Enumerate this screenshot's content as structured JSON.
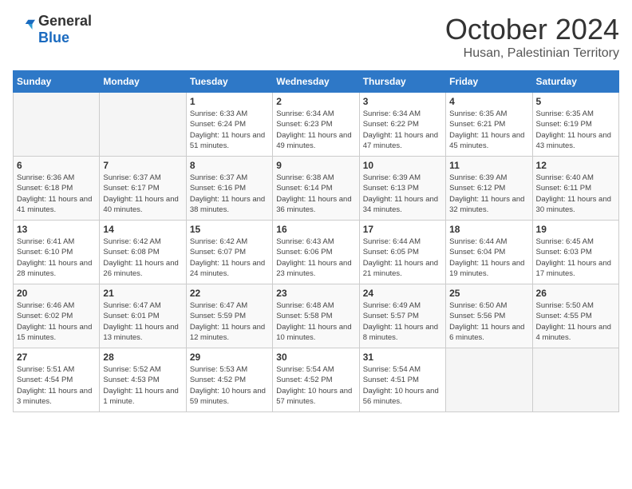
{
  "header": {
    "logo_general": "General",
    "logo_blue": "Blue",
    "month": "October 2024",
    "location": "Husan, Palestinian Territory"
  },
  "weekdays": [
    "Sunday",
    "Monday",
    "Tuesday",
    "Wednesday",
    "Thursday",
    "Friday",
    "Saturday"
  ],
  "weeks": [
    [
      {
        "day": "",
        "empty": true
      },
      {
        "day": "",
        "empty": true
      },
      {
        "day": "1",
        "sunrise": "Sunrise: 6:33 AM",
        "sunset": "Sunset: 6:24 PM",
        "daylight": "Daylight: 11 hours and 51 minutes."
      },
      {
        "day": "2",
        "sunrise": "Sunrise: 6:34 AM",
        "sunset": "Sunset: 6:23 PM",
        "daylight": "Daylight: 11 hours and 49 minutes."
      },
      {
        "day": "3",
        "sunrise": "Sunrise: 6:34 AM",
        "sunset": "Sunset: 6:22 PM",
        "daylight": "Daylight: 11 hours and 47 minutes."
      },
      {
        "day": "4",
        "sunrise": "Sunrise: 6:35 AM",
        "sunset": "Sunset: 6:21 PM",
        "daylight": "Daylight: 11 hours and 45 minutes."
      },
      {
        "day": "5",
        "sunrise": "Sunrise: 6:35 AM",
        "sunset": "Sunset: 6:19 PM",
        "daylight": "Daylight: 11 hours and 43 minutes."
      }
    ],
    [
      {
        "day": "6",
        "sunrise": "Sunrise: 6:36 AM",
        "sunset": "Sunset: 6:18 PM",
        "daylight": "Daylight: 11 hours and 41 minutes."
      },
      {
        "day": "7",
        "sunrise": "Sunrise: 6:37 AM",
        "sunset": "Sunset: 6:17 PM",
        "daylight": "Daylight: 11 hours and 40 minutes."
      },
      {
        "day": "8",
        "sunrise": "Sunrise: 6:37 AM",
        "sunset": "Sunset: 6:16 PM",
        "daylight": "Daylight: 11 hours and 38 minutes."
      },
      {
        "day": "9",
        "sunrise": "Sunrise: 6:38 AM",
        "sunset": "Sunset: 6:14 PM",
        "daylight": "Daylight: 11 hours and 36 minutes."
      },
      {
        "day": "10",
        "sunrise": "Sunrise: 6:39 AM",
        "sunset": "Sunset: 6:13 PM",
        "daylight": "Daylight: 11 hours and 34 minutes."
      },
      {
        "day": "11",
        "sunrise": "Sunrise: 6:39 AM",
        "sunset": "Sunset: 6:12 PM",
        "daylight": "Daylight: 11 hours and 32 minutes."
      },
      {
        "day": "12",
        "sunrise": "Sunrise: 6:40 AM",
        "sunset": "Sunset: 6:11 PM",
        "daylight": "Daylight: 11 hours and 30 minutes."
      }
    ],
    [
      {
        "day": "13",
        "sunrise": "Sunrise: 6:41 AM",
        "sunset": "Sunset: 6:10 PM",
        "daylight": "Daylight: 11 hours and 28 minutes."
      },
      {
        "day": "14",
        "sunrise": "Sunrise: 6:42 AM",
        "sunset": "Sunset: 6:08 PM",
        "daylight": "Daylight: 11 hours and 26 minutes."
      },
      {
        "day": "15",
        "sunrise": "Sunrise: 6:42 AM",
        "sunset": "Sunset: 6:07 PM",
        "daylight": "Daylight: 11 hours and 24 minutes."
      },
      {
        "day": "16",
        "sunrise": "Sunrise: 6:43 AM",
        "sunset": "Sunset: 6:06 PM",
        "daylight": "Daylight: 11 hours and 23 minutes."
      },
      {
        "day": "17",
        "sunrise": "Sunrise: 6:44 AM",
        "sunset": "Sunset: 6:05 PM",
        "daylight": "Daylight: 11 hours and 21 minutes."
      },
      {
        "day": "18",
        "sunrise": "Sunrise: 6:44 AM",
        "sunset": "Sunset: 6:04 PM",
        "daylight": "Daylight: 11 hours and 19 minutes."
      },
      {
        "day": "19",
        "sunrise": "Sunrise: 6:45 AM",
        "sunset": "Sunset: 6:03 PM",
        "daylight": "Daylight: 11 hours and 17 minutes."
      }
    ],
    [
      {
        "day": "20",
        "sunrise": "Sunrise: 6:46 AM",
        "sunset": "Sunset: 6:02 PM",
        "daylight": "Daylight: 11 hours and 15 minutes."
      },
      {
        "day": "21",
        "sunrise": "Sunrise: 6:47 AM",
        "sunset": "Sunset: 6:01 PM",
        "daylight": "Daylight: 11 hours and 13 minutes."
      },
      {
        "day": "22",
        "sunrise": "Sunrise: 6:47 AM",
        "sunset": "Sunset: 5:59 PM",
        "daylight": "Daylight: 11 hours and 12 minutes."
      },
      {
        "day": "23",
        "sunrise": "Sunrise: 6:48 AM",
        "sunset": "Sunset: 5:58 PM",
        "daylight": "Daylight: 11 hours and 10 minutes."
      },
      {
        "day": "24",
        "sunrise": "Sunrise: 6:49 AM",
        "sunset": "Sunset: 5:57 PM",
        "daylight": "Daylight: 11 hours and 8 minutes."
      },
      {
        "day": "25",
        "sunrise": "Sunrise: 6:50 AM",
        "sunset": "Sunset: 5:56 PM",
        "daylight": "Daylight: 11 hours and 6 minutes."
      },
      {
        "day": "26",
        "sunrise": "Sunrise: 5:50 AM",
        "sunset": "Sunset: 4:55 PM",
        "daylight": "Daylight: 11 hours and 4 minutes."
      }
    ],
    [
      {
        "day": "27",
        "sunrise": "Sunrise: 5:51 AM",
        "sunset": "Sunset: 4:54 PM",
        "daylight": "Daylight: 11 hours and 3 minutes."
      },
      {
        "day": "28",
        "sunrise": "Sunrise: 5:52 AM",
        "sunset": "Sunset: 4:53 PM",
        "daylight": "Daylight: 11 hours and 1 minute."
      },
      {
        "day": "29",
        "sunrise": "Sunrise: 5:53 AM",
        "sunset": "Sunset: 4:52 PM",
        "daylight": "Daylight: 10 hours and 59 minutes."
      },
      {
        "day": "30",
        "sunrise": "Sunrise: 5:54 AM",
        "sunset": "Sunset: 4:52 PM",
        "daylight": "Daylight: 10 hours and 57 minutes."
      },
      {
        "day": "31",
        "sunrise": "Sunrise: 5:54 AM",
        "sunset": "Sunset: 4:51 PM",
        "daylight": "Daylight: 10 hours and 56 minutes."
      },
      {
        "day": "",
        "empty": true
      },
      {
        "day": "",
        "empty": true
      }
    ]
  ]
}
